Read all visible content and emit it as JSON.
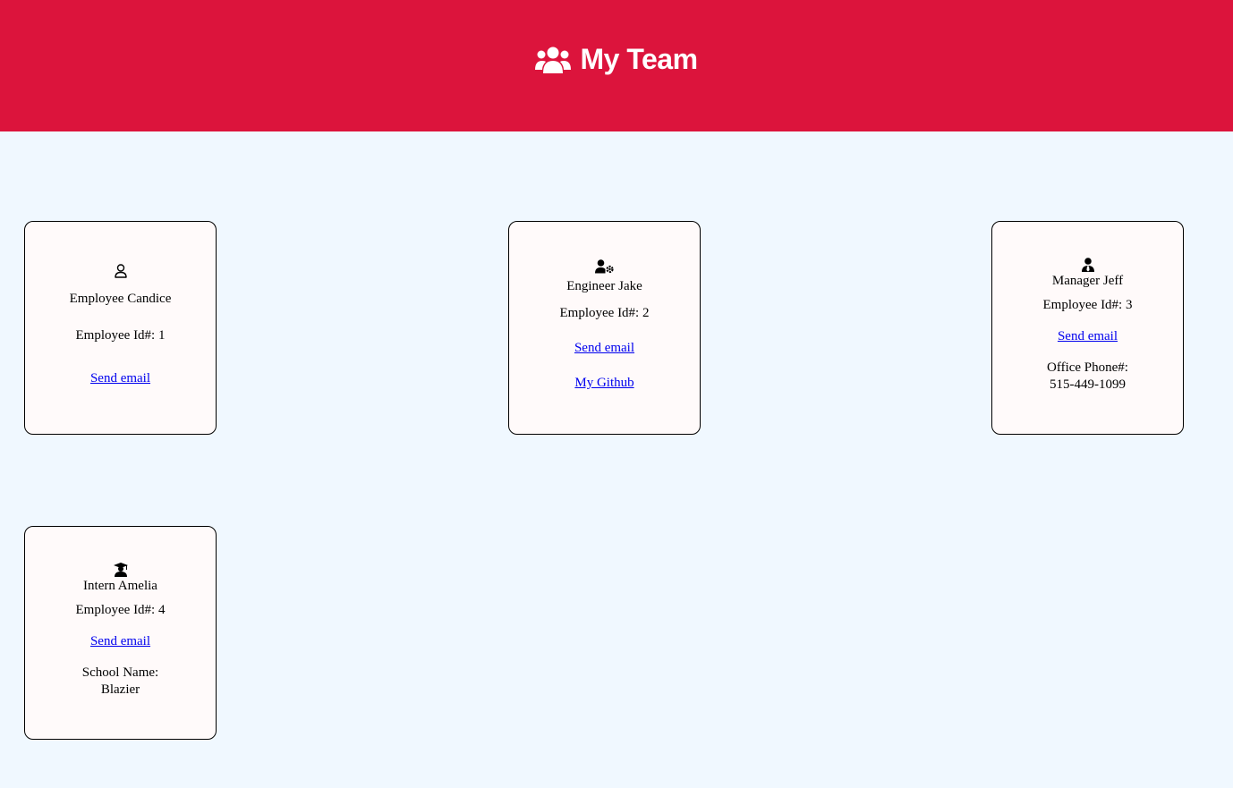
{
  "header": {
    "title": "My Team",
    "icon": "users-icon",
    "background": "#dc143c"
  },
  "colors": {
    "page_background": "#f0f8ff",
    "card_background": "#fffafa",
    "link": "#0000ee"
  },
  "cards": [
    {
      "icon": "user-icon",
      "name": "Employee Candice",
      "id_text": "Employee Id#: 1",
      "email_label": "Send email"
    },
    {
      "icon": "user-gear-icon",
      "name": "Engineer Jake",
      "id_text": "Employee Id#: 2",
      "email_label": "Send email",
      "github_label": "My Github"
    },
    {
      "icon": "user-tie-icon",
      "name": "Manager Jeff",
      "id_text": "Employee Id#: 3",
      "email_label": "Send email",
      "extra_label": "Office Phone#:",
      "extra_value": "515-449-1099"
    },
    {
      "icon": "user-graduate-icon",
      "name": "Intern Amelia",
      "id_text": "Employee Id#: 4",
      "email_label": "Send email",
      "extra_label": "School Name:",
      "extra_value": "Blazier"
    }
  ]
}
